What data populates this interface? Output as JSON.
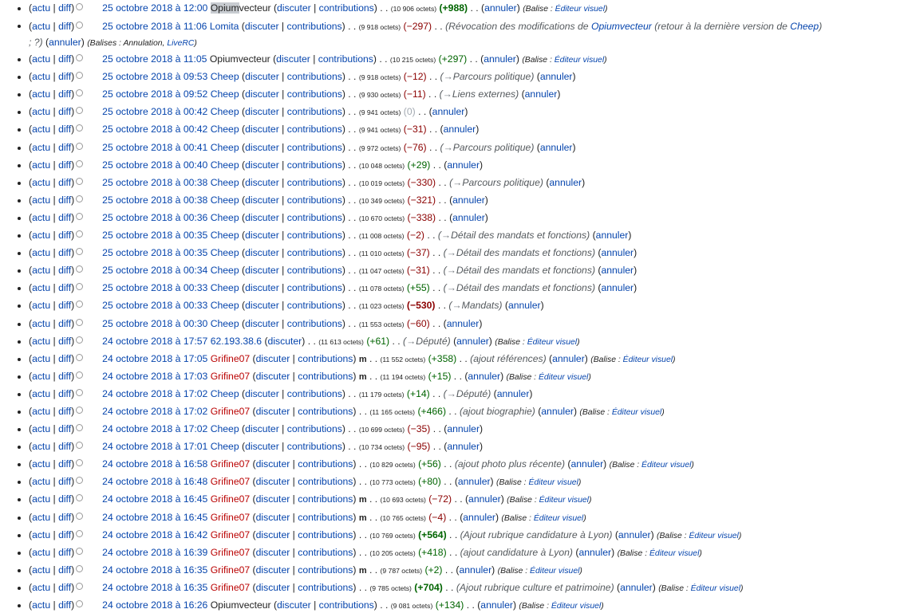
{
  "labels": {
    "actu": "actu",
    "diff": "diff",
    "discuter": "discuter",
    "contributions": "contributions",
    "annuler": "annuler",
    "minor": "m",
    "tag_prefix": "Balise : ",
    "tags_prefix": "Balises : ",
    "tag_editor": "Éditeur visuel",
    "tag_undo": "Annulation",
    "tag_liverc": "LiveRC",
    "arrow": "→"
  },
  "revisions": [
    {
      "date": "25 octobre 2018 à 12:00",
      "user_hl": "Opium",
      "user": "vecteur",
      "user_red": false,
      "contribs": true,
      "minor": false,
      "size": "(10 906 octets)",
      "diff": "+988",
      "sign": "pos",
      "big": true,
      "comment": "",
      "section": false,
      "tags": "editor"
    },
    {
      "date": "25 octobre 2018 à 11:06",
      "user": "Lomita",
      "user_red": false,
      "contribs": true,
      "minor": false,
      "size": "(9 918 octets)",
      "diff": "−297",
      "sign": "neg",
      "big": false,
      "comment_pre": "(Révocation des modifications de ",
      "comment_link1": "Opiumvecteur",
      "comment_mid": " (retour à la dernière version de ",
      "comment_link2": "Cheep",
      "comment_post": ") ; ?)",
      "tags": "undo",
      "wrap": true
    },
    {
      "date": "25 octobre 2018 à 11:05",
      "user": "Opiumvecteur",
      "user_red": false,
      "contribs": true,
      "minor": false,
      "size": "(10 215 octets)",
      "diff": "+297",
      "sign": "pos",
      "big": false,
      "comment": "",
      "tags": "editor"
    },
    {
      "date": "25 octobre 2018 à 09:53",
      "user": "Cheep",
      "user_red": false,
      "contribs": true,
      "minor": false,
      "size": "(9 918 octets)",
      "diff": "−12",
      "sign": "neg",
      "comment": "Parcours politique",
      "section": true,
      "tags": ""
    },
    {
      "date": "25 octobre 2018 à 09:52",
      "user": "Cheep",
      "user_red": false,
      "contribs": true,
      "minor": false,
      "size": "(9 930 octets)",
      "diff": "−11",
      "sign": "neg",
      "comment": "Liens externes",
      "section": true,
      "tags": ""
    },
    {
      "date": "25 octobre 2018 à 00:42",
      "user": "Cheep",
      "user_red": false,
      "contribs": true,
      "minor": false,
      "size": "(9 941 octets)",
      "diff": "0",
      "sign": "zero",
      "comment": "",
      "tags": ""
    },
    {
      "date": "25 octobre 2018 à 00:42",
      "user": "Cheep",
      "user_red": false,
      "contribs": true,
      "minor": false,
      "size": "(9 941 octets)",
      "diff": "−31",
      "sign": "neg",
      "comment": "",
      "tags": ""
    },
    {
      "date": "25 octobre 2018 à 00:41",
      "user": "Cheep",
      "user_red": false,
      "contribs": true,
      "minor": false,
      "size": "(9 972 octets)",
      "diff": "−76",
      "sign": "neg",
      "comment": "Parcours politique",
      "section": true,
      "tags": ""
    },
    {
      "date": "25 octobre 2018 à 00:40",
      "user": "Cheep",
      "user_red": false,
      "contribs": true,
      "minor": false,
      "size": "(10 048 octets)",
      "diff": "+29",
      "sign": "pos",
      "comment": "",
      "tags": ""
    },
    {
      "date": "25 octobre 2018 à 00:38",
      "user": "Cheep",
      "user_red": false,
      "contribs": true,
      "minor": false,
      "size": "(10 019 octets)",
      "diff": "−330",
      "sign": "neg",
      "comment": "Parcours politique",
      "section": true,
      "tags": ""
    },
    {
      "date": "25 octobre 2018 à 00:38",
      "user": "Cheep",
      "user_red": false,
      "contribs": true,
      "minor": false,
      "size": "(10 349 octets)",
      "diff": "−321",
      "sign": "neg",
      "comment": "",
      "tags": ""
    },
    {
      "date": "25 octobre 2018 à 00:36",
      "user": "Cheep",
      "user_red": false,
      "contribs": true,
      "minor": false,
      "size": "(10 670 octets)",
      "diff": "−338",
      "sign": "neg",
      "comment": "",
      "tags": ""
    },
    {
      "date": "25 octobre 2018 à 00:35",
      "user": "Cheep",
      "user_red": false,
      "contribs": true,
      "minor": false,
      "size": "(11 008 octets)",
      "diff": "−2",
      "sign": "neg",
      "comment": "Détail des mandats et fonctions",
      "section": true,
      "tags": ""
    },
    {
      "date": "25 octobre 2018 à 00:35",
      "user": "Cheep",
      "user_red": false,
      "contribs": true,
      "minor": false,
      "size": "(11 010 octets)",
      "diff": "−37",
      "sign": "neg",
      "comment": "Détail des mandats et fonctions",
      "section": true,
      "tags": ""
    },
    {
      "date": "25 octobre 2018 à 00:34",
      "user": "Cheep",
      "user_red": false,
      "contribs": true,
      "minor": false,
      "size": "(11 047 octets)",
      "diff": "−31",
      "sign": "neg",
      "comment": "Détail des mandats et fonctions",
      "section": true,
      "tags": ""
    },
    {
      "date": "25 octobre 2018 à 00:33",
      "user": "Cheep",
      "user_red": false,
      "contribs": true,
      "minor": false,
      "size": "(11 078 octets)",
      "diff": "+55",
      "sign": "pos",
      "comment": "Détail des mandats et fonctions",
      "section": true,
      "tags": ""
    },
    {
      "date": "25 octobre 2018 à 00:33",
      "user": "Cheep",
      "user_red": false,
      "contribs": true,
      "minor": false,
      "size": "(11 023 octets)",
      "diff": "−530",
      "sign": "neg",
      "big": true,
      "comment": "Mandats",
      "section": true,
      "tags": ""
    },
    {
      "date": "25 octobre 2018 à 00:30",
      "user": "Cheep",
      "user_red": false,
      "contribs": true,
      "minor": false,
      "size": "(11 553 octets)",
      "diff": "−60",
      "sign": "neg",
      "comment": "",
      "tags": ""
    },
    {
      "date": "24 octobre 2018 à 17:57",
      "user": "62.193.38.6",
      "user_red": false,
      "contribs": false,
      "minor": false,
      "size": "(11 613 octets)",
      "diff": "+61",
      "sign": "pos",
      "comment": "Député",
      "section": true,
      "tags": "editor"
    },
    {
      "date": "24 octobre 2018 à 17:05",
      "user": "Grifine07",
      "user_red": true,
      "contribs": true,
      "minor": true,
      "size": "(11 552 octets)",
      "diff": "+358",
      "sign": "pos",
      "comment": "ajout références",
      "section": false,
      "tags": "editor"
    },
    {
      "date": "24 octobre 2018 à 17:03",
      "user": "Grifine07",
      "user_red": true,
      "contribs": true,
      "minor": true,
      "size": "(11 194 octets)",
      "diff": "+15",
      "sign": "pos",
      "comment": "",
      "tags": "editor"
    },
    {
      "date": "24 octobre 2018 à 17:02",
      "user": "Cheep",
      "user_red": false,
      "contribs": true,
      "minor": false,
      "size": "(11 179 octets)",
      "diff": "+14",
      "sign": "pos",
      "comment": "Député",
      "section": true,
      "tags": ""
    },
    {
      "date": "24 octobre 2018 à 17:02",
      "user": "Grifine07",
      "user_red": true,
      "contribs": true,
      "minor": false,
      "size": "(11 165 octets)",
      "diff": "+466",
      "sign": "pos",
      "comment": "ajout biographie",
      "section": false,
      "tags": "editor"
    },
    {
      "date": "24 octobre 2018 à 17:02",
      "user": "Cheep",
      "user_red": false,
      "contribs": true,
      "minor": false,
      "size": "(10 699 octets)",
      "diff": "−35",
      "sign": "neg",
      "comment": "",
      "tags": ""
    },
    {
      "date": "24 octobre 2018 à 17:01",
      "user": "Cheep",
      "user_red": false,
      "contribs": true,
      "minor": false,
      "size": "(10 734 octets)",
      "diff": "−95",
      "sign": "neg",
      "comment": "",
      "tags": ""
    },
    {
      "date": "24 octobre 2018 à 16:58",
      "user": "Grifine07",
      "user_red": true,
      "contribs": true,
      "minor": false,
      "size": "(10 829 octets)",
      "diff": "+56",
      "sign": "pos",
      "comment": "ajout photo plus récente",
      "section": false,
      "tags": "editor"
    },
    {
      "date": "24 octobre 2018 à 16:48",
      "user": "Grifine07",
      "user_red": true,
      "contribs": true,
      "minor": false,
      "size": "(10 773 octets)",
      "diff": "+80",
      "sign": "pos",
      "comment": "",
      "tags": "editor"
    },
    {
      "date": "24 octobre 2018 à 16:45",
      "user": "Grifine07",
      "user_red": true,
      "contribs": true,
      "minor": true,
      "size": "(10 693 octets)",
      "diff": "−72",
      "sign": "neg",
      "comment": "",
      "tags": "editor"
    },
    {
      "date": "24 octobre 2018 à 16:45",
      "user": "Grifine07",
      "user_red": true,
      "contribs": true,
      "minor": true,
      "size": "(10 765 octets)",
      "diff": "−4",
      "sign": "neg",
      "comment": "",
      "tags": "editor"
    },
    {
      "date": "24 octobre 2018 à 16:42",
      "user": "Grifine07",
      "user_red": true,
      "contribs": true,
      "minor": false,
      "size": "(10 769 octets)",
      "diff": "+564",
      "sign": "pos",
      "big": true,
      "comment": "Ajout rubrique candidature à Lyon",
      "section": false,
      "tags": "editor"
    },
    {
      "date": "24 octobre 2018 à 16:39",
      "user": "Grifine07",
      "user_red": true,
      "contribs": true,
      "minor": false,
      "size": "(10 205 octets)",
      "diff": "+418",
      "sign": "pos",
      "comment": "ajout candidature à Lyon",
      "section": false,
      "tags": "editor"
    },
    {
      "date": "24 octobre 2018 à 16:35",
      "user": "Grifine07",
      "user_red": true,
      "contribs": true,
      "minor": true,
      "size": "(9 787 octets)",
      "diff": "+2",
      "sign": "pos",
      "comment": "",
      "tags": "editor"
    },
    {
      "date": "24 octobre 2018 à 16:35",
      "user": "Grifine07",
      "user_red": true,
      "contribs": true,
      "minor": false,
      "size": "(9 785 octets)",
      "diff": "+704",
      "sign": "pos",
      "big": true,
      "comment": "Ajout rubrique culture et patrimoine",
      "section": false,
      "tags": "editor"
    },
    {
      "date": "24 octobre 2018 à 16:26",
      "user": "Opiumvecteur",
      "user_red": false,
      "contribs": true,
      "minor": false,
      "size": "(9 081 octets)",
      "diff": "+134",
      "sign": "pos",
      "comment": "",
      "tags": "editor"
    }
  ]
}
